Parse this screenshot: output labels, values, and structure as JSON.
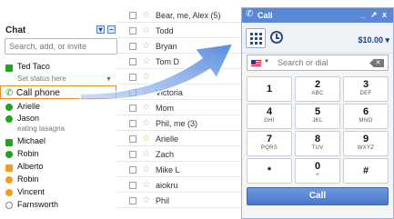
{
  "chat": {
    "title": "Chat",
    "search_placeholder": "Search, add, or invite",
    "self": {
      "name": "Ted Taco",
      "status": "Set status here"
    },
    "call_phone_label": "Call phone",
    "contacts": [
      {
        "name": "Arielle",
        "presence": "available"
      },
      {
        "name": "Jason",
        "presence": "available",
        "status": "eating lasagna"
      },
      {
        "name": "Michael",
        "presence": "video-available"
      },
      {
        "name": "Robin",
        "presence": "available"
      },
      {
        "name": "Alberto",
        "presence": "video-idle"
      },
      {
        "name": "Robin",
        "presence": "idle"
      },
      {
        "name": "Vincent",
        "presence": "idle"
      },
      {
        "name": "Farnsworth",
        "presence": "offline"
      }
    ]
  },
  "mail": {
    "rows": [
      {
        "sender": "Bear, me, Alex (5)",
        "starred": false
      },
      {
        "sender": "Todd",
        "starred": false
      },
      {
        "sender": "Bryan",
        "starred": false
      },
      {
        "sender": "Tom D",
        "starred": false
      },
      {
        "sender": "",
        "starred": false
      },
      {
        "sender": "Victoria",
        "starred": false
      },
      {
        "sender": "Mom",
        "starred": false
      },
      {
        "sender": "Phil, me (3)",
        "starred": false
      },
      {
        "sender": "Arielle",
        "starred": true
      },
      {
        "sender": "Zach",
        "starred": false
      },
      {
        "sender": "Mike L",
        "starred": false
      },
      {
        "sender": "aiokru",
        "starred": false
      },
      {
        "sender": "Phil",
        "starred": false
      }
    ]
  },
  "call_dialog": {
    "title": "Call",
    "controls": [
      "_",
      "↗",
      "x"
    ],
    "credit": "$10.00",
    "dial_placeholder": "Search or dial",
    "keys": [
      {
        "digit": "1",
        "letters": ""
      },
      {
        "digit": "2",
        "letters": "ABC"
      },
      {
        "digit": "3",
        "letters": "DEF"
      },
      {
        "digit": "4",
        "letters": "GHI"
      },
      {
        "digit": "5",
        "letters": "JKL"
      },
      {
        "digit": "6",
        "letters": "MNO"
      },
      {
        "digit": "7",
        "letters": "PQRS"
      },
      {
        "digit": "8",
        "letters": "TUV"
      },
      {
        "digit": "9",
        "letters": "WXYZ"
      },
      {
        "digit": "*",
        "letters": ""
      },
      {
        "digit": "0",
        "letters": "+"
      },
      {
        "digit": "#",
        "letters": ""
      }
    ],
    "call_button": "Call"
  },
  "colors": {
    "titlebar": "#5b88d6",
    "call_button": "#4a78cc",
    "highlight_border": "#f08a24",
    "arrow": "#5b8fe0",
    "available": "#24a024",
    "idle": "#f0a018"
  }
}
